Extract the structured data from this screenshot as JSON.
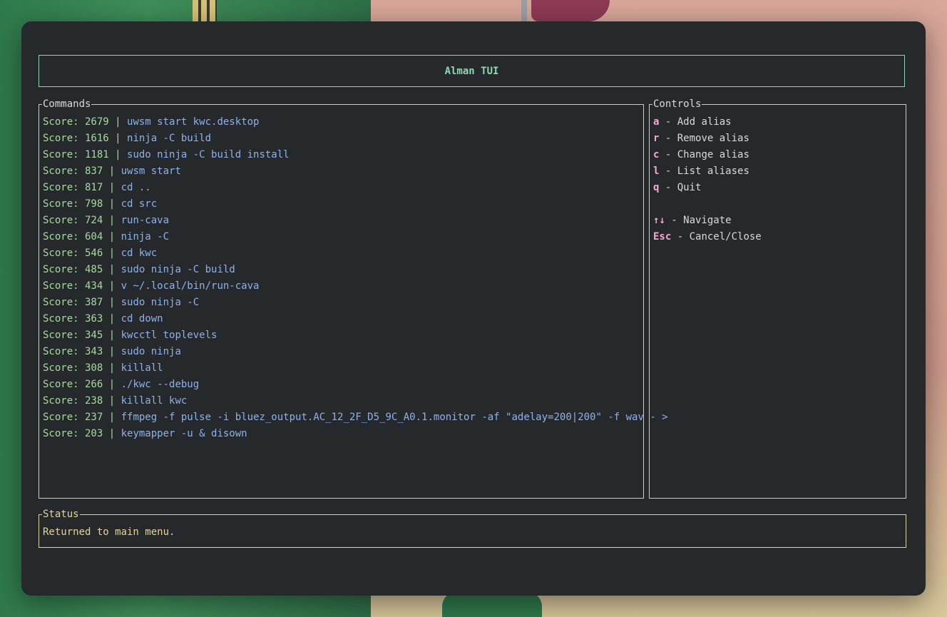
{
  "app": {
    "title": "Alman TUI"
  },
  "commands": {
    "legend": "Commands",
    "items": [
      {
        "score": "2679",
        "cmd": "uwsm start kwc.desktop"
      },
      {
        "score": "1616",
        "cmd": "ninja -C build"
      },
      {
        "score": "1181",
        "cmd": "sudo ninja -C build install"
      },
      {
        "score": "837",
        "cmd": "uwsm start"
      },
      {
        "score": "817",
        "cmd": "cd .."
      },
      {
        "score": "798",
        "cmd": "cd src"
      },
      {
        "score": "724",
        "cmd": "run-cava"
      },
      {
        "score": "604",
        "cmd": "ninja -C"
      },
      {
        "score": "546",
        "cmd": "cd kwc"
      },
      {
        "score": "485",
        "cmd": "sudo ninja -C build"
      },
      {
        "score": "434",
        "cmd": "v ~/.local/bin/run-cava"
      },
      {
        "score": "387",
        "cmd": "sudo ninja -C"
      },
      {
        "score": "363",
        "cmd": "cd down"
      },
      {
        "score": "345",
        "cmd": "kwcctl toplevels"
      },
      {
        "score": "343",
        "cmd": "sudo ninja"
      },
      {
        "score": "308",
        "cmd": "killall"
      },
      {
        "score": "266",
        "cmd": "./kwc --debug"
      },
      {
        "score": "238",
        "cmd": "killall kwc"
      },
      {
        "score": "237",
        "cmd": "ffmpeg -f pulse -i bluez_output.AC_12_2F_D5_9C_A0.1.monitor -af \"adelay=200|200\" -f wav - >"
      },
      {
        "score": "203",
        "cmd": "keymapper -u & disown"
      }
    ],
    "score_prefix": "Score: ",
    "separator": " | "
  },
  "controls": {
    "legend": "Controls",
    "items": [
      {
        "key": "a",
        "label": " - Add alias"
      },
      {
        "key": "r",
        "label": " - Remove alias"
      },
      {
        "key": "c",
        "label": " - Change alias"
      },
      {
        "key": "l",
        "label": " - List aliases"
      },
      {
        "key": "q",
        "label": " - Quit"
      }
    ],
    "nav": [
      {
        "key": "↑↓",
        "label": " - Navigate"
      },
      {
        "key": "Esc",
        "label": " - Cancel/Close"
      }
    ]
  },
  "status": {
    "legend": "Status",
    "message": "Returned to main menu."
  }
}
